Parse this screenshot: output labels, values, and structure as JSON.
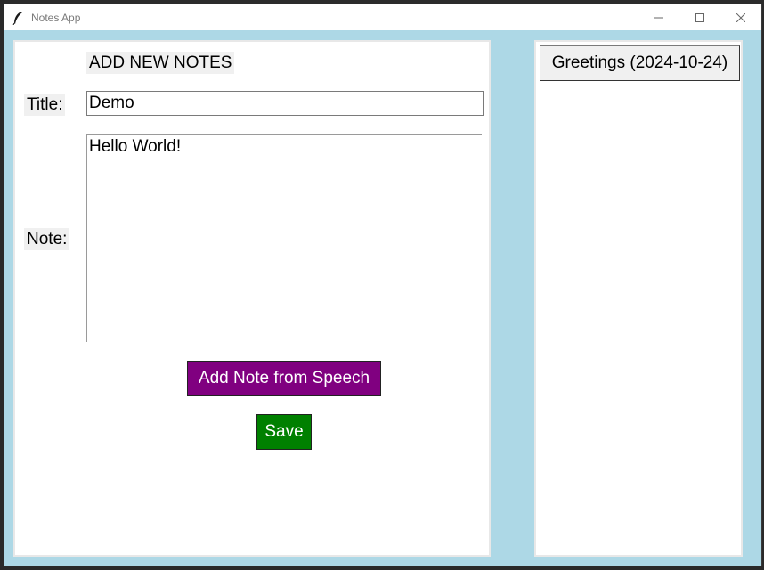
{
  "window": {
    "title": "Notes App",
    "icon": "feather-icon",
    "controls": {
      "minimize": "—",
      "maximize": "☐",
      "close": "✕"
    }
  },
  "form": {
    "header": "ADD NEW NOTES",
    "title_label": "Title:",
    "title_value": "Demo",
    "note_label": "Note:",
    "note_value": "Hello World!",
    "speech_button": "Add Note from Speech",
    "save_button": "Save"
  },
  "notes_list": {
    "items": [
      {
        "label": "Greetings (2024-10-24)"
      }
    ]
  },
  "colors": {
    "background": "#add8e6",
    "speech_button": "#800080",
    "save_button": "#008000"
  }
}
